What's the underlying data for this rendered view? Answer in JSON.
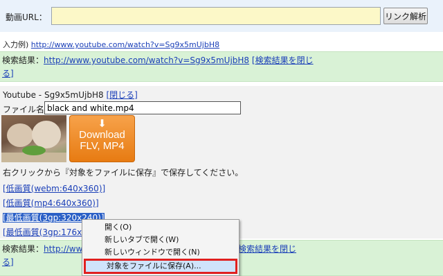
{
  "top": {
    "url_label": "動画URL：",
    "url_value": "",
    "analyze_button": "リンク解析"
  },
  "example": {
    "label": "入力例) ",
    "link": "http://www.youtube.com/watch?v=Sg9x5mUjbH8"
  },
  "result1": {
    "label": "検索結果：",
    "url": "http://www.youtube.com/watch?v=Sg9x5mUjbH8",
    "close_part1": "[検索結果を閉じ",
    "close_part2": "る]"
  },
  "detail": {
    "video_id_text": "Youtube - Sg9x5mUjbH8 ",
    "close_link": "[閉じる]",
    "filename_label": "ファイル名:",
    "filename_value": "black and white.mp4",
    "download_arrow": "⬇",
    "download_line1": "Download",
    "download_line2": "FLV, MP4",
    "hint": "右クリックから『対象をファイルに保存』で保存してください。",
    "quality_links": [
      "[低画質(webm:640x360)]",
      "[低画質(mp4:640x360)]",
      "[最低画質(3gp:320x240)]",
      "[最低画質(3gp:176x1"
    ]
  },
  "result2": {
    "label": "検索結果：",
    "url_fragment": "http://ww",
    "close_fragment": "検索結果を閉じ",
    "close_part2": "る]"
  },
  "context_menu": {
    "items": [
      "開く(O)",
      "新しいタブで開く(W)",
      "新しいウィンドウで開く(N)",
      "対象をファイルに保存(A)..."
    ]
  },
  "colors": {
    "link": "#1a3fb8",
    "input_bg": "#fcf8c8",
    "result_bg": "#d9f2d6",
    "download_orange": "#e77b12",
    "highlight_border": "#e02020"
  }
}
